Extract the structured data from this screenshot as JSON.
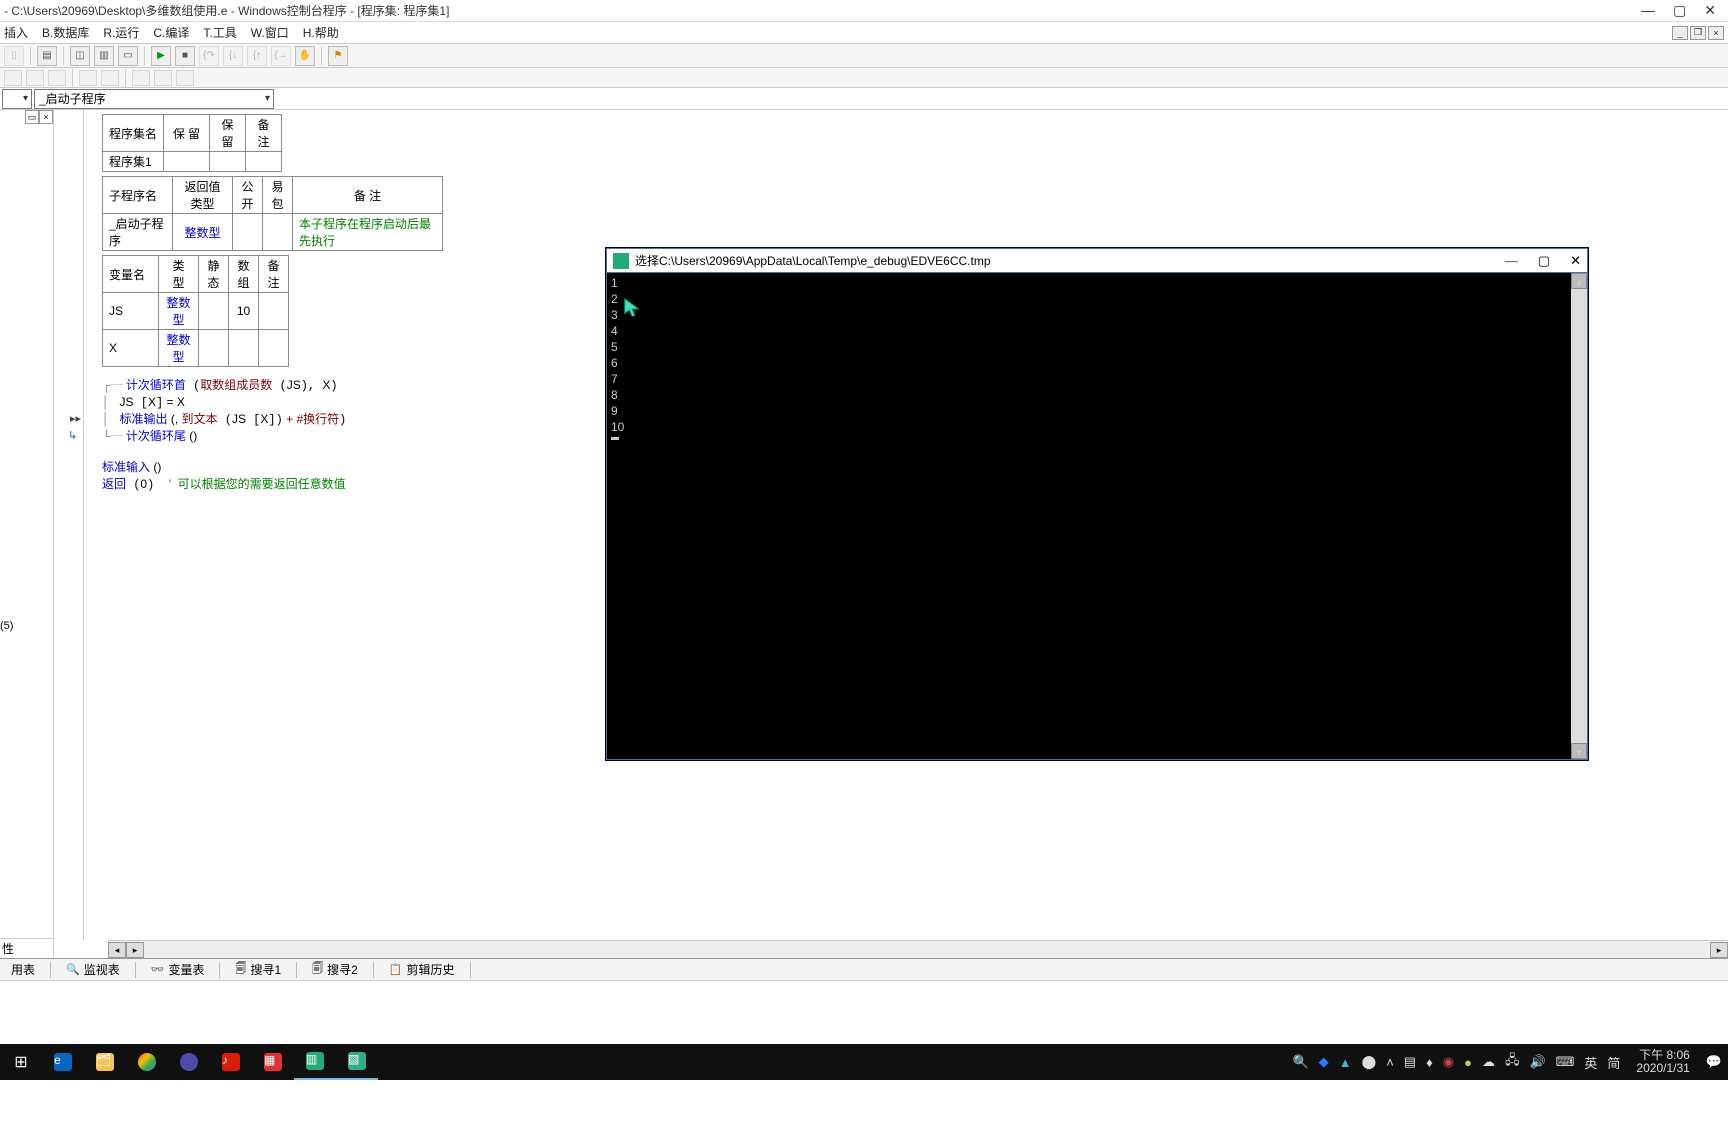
{
  "window": {
    "title": "- C:\\Users\\20969\\Desktop\\多维数组使用.e - Windows控制台程序 - [程序集: 程序集1]"
  },
  "menu": {
    "insert": "插入",
    "database": "B.数据库",
    "run": "R.运行",
    "compile": "C.编译",
    "tools": "T.工具",
    "window": "W.窗口",
    "help": "H.帮助"
  },
  "combo": {
    "sub": "_启动子程序"
  },
  "table1": {
    "h1": "程序集名",
    "h2": "保  留",
    "h3": "保  留",
    "h4": "备  注",
    "r1": "程序集1"
  },
  "table2": {
    "h1": "子程序名",
    "h2": "返回值类型",
    "h3": "公开",
    "h4": "易包",
    "h5": "备  注",
    "r1_name": "_启动子程序",
    "r1_type": "整数型",
    "r1_note": "本子程序在程序启动后最先执行"
  },
  "table3": {
    "h1": "变量名",
    "h2": "类  型",
    "h3": "静态",
    "h4": "数组",
    "h5": "备  注",
    "r1_name": "JS",
    "r1_type": "整数型",
    "r1_arr": "10",
    "r2_name": "X",
    "r2_type": "整数型"
  },
  "code": {
    "l1a": "计次循环首",
    "l1b": "取数组成员数",
    "l1c": "JS",
    "l1d": "X",
    "l2a": "JS",
    "l2b": "X",
    "l2c": " = X",
    "l3a": "标准输出",
    "l3b": " (, ",
    "l3c": "到文本",
    "l3d": "JS",
    "l3e": "X",
    "l3f": " + ",
    "l3g": "#换行符",
    "l4a": "计次循环尾",
    "l4b": " ()",
    "l5a": "标准输入",
    "l5b": " ()",
    "l6a": "返回",
    "l6b": "0",
    "l6c": "'  可以根据您的需要返回任意数值"
  },
  "side": {
    "bracket": "(5)",
    "prop": "性"
  },
  "bottom_tabs": {
    "t1": "用表",
    "t2": "监视表",
    "t3": "变量表",
    "t4": "搜寻1",
    "t5": "搜寻2",
    "t6": "剪辑历史"
  },
  "console": {
    "title": "选择C:\\Users\\20969\\AppData\\Local\\Temp\\e_debug\\EDVE6CC.tmp",
    "lines": [
      "1",
      "2",
      "3",
      "4",
      "5",
      "6",
      "7",
      "8",
      "9",
      "10"
    ]
  },
  "tray": {
    "ime1": "英",
    "ime2": "简",
    "time": "下午 8:06",
    "date": "2020/1/31"
  }
}
